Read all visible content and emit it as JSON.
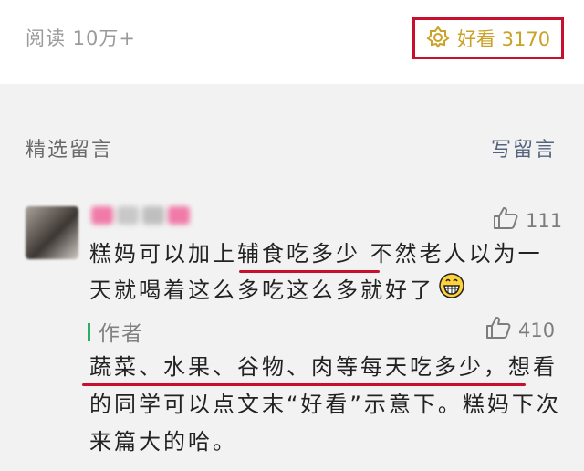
{
  "header": {
    "read_count": "阅读 10万+",
    "like_label": "好看 3170"
  },
  "comments_section": {
    "title": "精选留言",
    "write_button": "写留言"
  },
  "comment": {
    "likes": "111",
    "text": "糕妈可以加上辅食吃多少 不然老人以为一天就喝着这么多吃这么多就好了",
    "avatar_icon": "user-avatar-blurred",
    "emoji_icon": "grinning-face-icon"
  },
  "reply": {
    "label": "作者",
    "likes": "410",
    "text": "蔬菜、水果、谷物、肉等每天吃多少，想看的同学可以点文末“好看”示意下。糕妈下次来篇大的哈。"
  },
  "colors": {
    "highlight": "#c8102e",
    "gold": "#c9a227",
    "accent_green": "#2aae67",
    "link": "#55647c"
  }
}
